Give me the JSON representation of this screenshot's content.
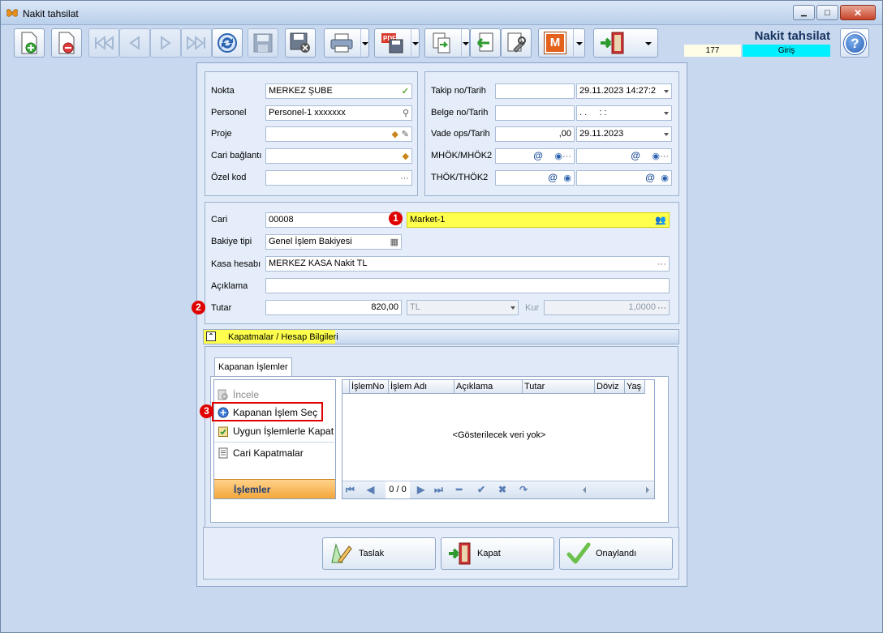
{
  "window": {
    "title": "Nakit tahsilat",
    "minimize": "▁",
    "maximize": "□",
    "close": "✕"
  },
  "header": {
    "title": "Nakit tahsilat",
    "record_count": "177",
    "mode": "Giriş"
  },
  "toolbar": {
    "icons": [
      "new-document-icon",
      "delete-document-icon",
      "first-record-icon",
      "previous-record-icon",
      "next-record-icon",
      "last-record-icon",
      "refresh-icon",
      "save-icon",
      "save-close-icon",
      "print-icon",
      "pdf-icon",
      "export-icon",
      "import-icon",
      "settings-icon",
      "m-logo-icon",
      "exit-door-icon",
      "help-icon"
    ],
    "m_label": "M",
    "help_label": "?"
  },
  "form_left": {
    "nokta_label": "Nokta",
    "nokta_value": "MERKEZ ŞUBE",
    "personel_label": "Personel",
    "personel_value": "Personel-1 xxxxxxx",
    "proje_label": "Proje",
    "proje_value": "",
    "cari_baglanti_label": "Cari bağlantı",
    "cari_baglanti_value": "",
    "ozel_kod_label": "Özel kod",
    "ozel_kod_value": ""
  },
  "form_right": {
    "takip_label": "Takip no/Tarih",
    "takip_no": "",
    "takip_tarih": "29.11.2023 14:27:2",
    "belge_label": "Belge no/Tarih",
    "belge_no": "",
    "belge_tarih": ". .     : :",
    "vade_label": "Vade ops/Tarih",
    "vade_ops": ",00",
    "vade_tarih": "29.11.2023",
    "mhok_label": "MHÖK/MHÖK2",
    "thok_label": "THÖK/THÖK2",
    "at_symbol": "@",
    "dots": "···"
  },
  "cari_section": {
    "cari_label": "Cari",
    "cari_code": "00008",
    "cari_name": "Market-1",
    "bakiye_label": "Bakiye tipi",
    "bakiye_value": "Genel İşlem Bakiyesi",
    "kasa_label": "Kasa hesabı",
    "kasa_value": "MERKEZ KASA Nakit TL",
    "aciklama_label": "Açıklama",
    "aciklama_value": "",
    "tutar_label": "Tutar",
    "tutar_value": "820,00",
    "currency": "TL",
    "kur_label": "Kur",
    "kur_value": "1,0000"
  },
  "callouts": [
    "1",
    "2",
    "3"
  ],
  "kapatmalar": {
    "bar_label": "Kapatmalar / Hesap Bilgileri",
    "tab_label": "Kapanan İşlemler",
    "side_items": [
      {
        "label": "İncele",
        "icon": "inspect-icon"
      },
      {
        "label": "Kapanan İşlem Seç",
        "icon": "add-circle-icon"
      },
      {
        "label": "Uygun İşlemlerle Kapat",
        "icon": "clipboard-check-icon"
      },
      {
        "label": "Cari Kapatmalar",
        "icon": "document-list-icon"
      }
    ],
    "side_footer": "İşlemler",
    "grid_columns": [
      "İşlemNo",
      "İşlem Adı",
      "Açıklama",
      "Tutar",
      "Döviz",
      "Yaş"
    ],
    "empty_text": "<Gösterilecek veri yok>",
    "pager": "0 / 0"
  },
  "actions": {
    "taslak": "Taslak",
    "kapat": "Kapat",
    "onaylandi": "Onaylandı"
  },
  "colors": {
    "highlight": "#ffff4d",
    "callout": "#e00000",
    "mode_bg": "#00f0ff"
  }
}
